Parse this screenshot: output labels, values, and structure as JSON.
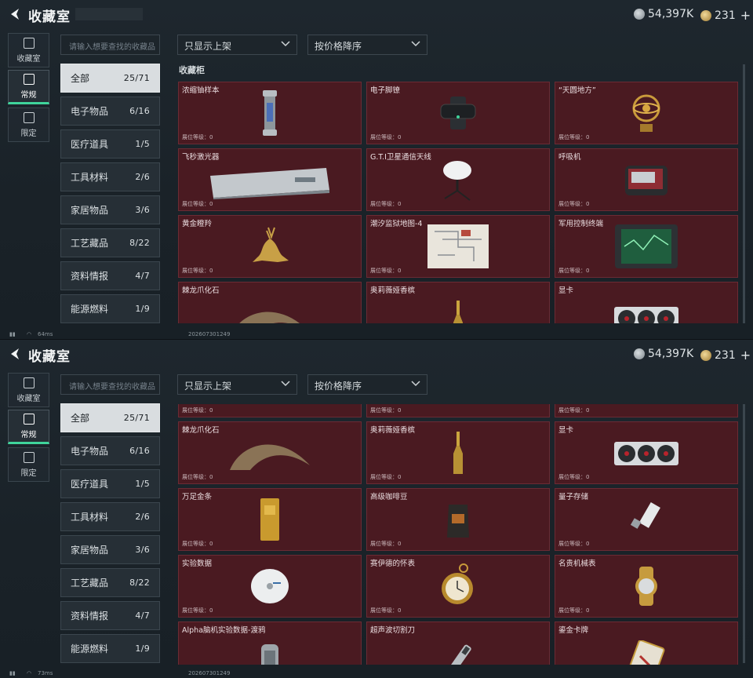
{
  "title": "收藏室",
  "currency": {
    "coins": "54,397K",
    "gems": "231"
  },
  "nav": [
    {
      "label": "收藏室",
      "icon": "collection-icon"
    },
    {
      "label": "常规",
      "icon": "image-icon"
    },
    {
      "label": "限定",
      "icon": "photo-icon"
    }
  ],
  "search_placeholder": "请输入想要查找的收藏品",
  "filter_shelf": "只显示上架",
  "filter_sort": "按价格降序",
  "section_label": "收藏柜",
  "categories": [
    {
      "label": "全部",
      "count": "25/71"
    },
    {
      "label": "电子物品",
      "count": "6/16"
    },
    {
      "label": "医疗道具",
      "count": "1/5"
    },
    {
      "label": "工具材料",
      "count": "2/6"
    },
    {
      "label": "家居物品",
      "count": "3/6"
    },
    {
      "label": "工艺藏品",
      "count": "8/22"
    },
    {
      "label": "资料情报",
      "count": "4/7"
    },
    {
      "label": "能源燃料",
      "count": "1/9"
    }
  ],
  "level_label": "展位等级：0",
  "items_top": [
    "浓缩铀样本",
    "电子脚镣",
    "“天圆地方”",
    "飞秒激光器",
    "G.T.I卫星通信天线",
    "呼吸机",
    "黄金瞪羚",
    "潮汐监狱地图-4",
    "军用控制终端",
    "棘龙爪化石",
    "奥莉薇娅香槟",
    "显卡"
  ],
  "items_bottom": [
    "棘龙爪化石",
    "奥莉薇娅香槟",
    "显卡",
    "万足金条",
    "高级咖啡豆",
    "量子存储",
    "实验数据",
    "赛伊德的怀表",
    "名贵机械表",
    "Alpha脑机实验数据-渡鸦",
    "超声波切割刀",
    "鎏金卡牌"
  ],
  "status": {
    "ping_top": "64ms",
    "ping_bottom": "73ms",
    "id": "202607301249"
  }
}
